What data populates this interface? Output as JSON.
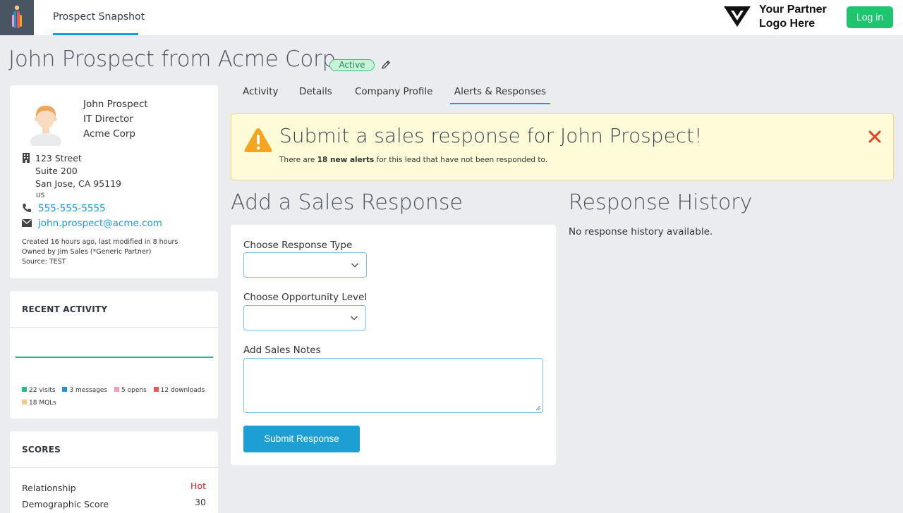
{
  "topbar": {
    "nav_tab": "Prospect Snapshot",
    "partner_logo_text": "Your Partner\nLogo Here",
    "login_label": "Log in"
  },
  "page": {
    "title": "John Prospect from Acme Corp",
    "status": "Active"
  },
  "profile": {
    "name": "John Prospect",
    "job_title": "IT Director",
    "company": "Acme Corp",
    "address": [
      "123 Street",
      "Suite 200",
      "San Jose, CA 95119"
    ],
    "country": "US",
    "phone": "555-555-5555",
    "email": "john.prospect@acme.com",
    "meta": [
      "Created 16 hours ago, last modified in 8 hours",
      "Owned by Jim Sales (*Generic Partner)",
      "Source: TEST"
    ]
  },
  "recent_activity": {
    "header": "RECENT ACTIVITY",
    "legend": [
      {
        "label": "22 visits",
        "color": "#22c083"
      },
      {
        "label": "3 messages",
        "color": "#1f94cf"
      },
      {
        "label": "5 opens",
        "color": "#f29bc8"
      },
      {
        "label": "12 downloads",
        "color": "#ee5555"
      },
      {
        "label": "18 MQLs",
        "color": "#f6c98a"
      }
    ],
    "line_color": "#1fb88a"
  },
  "scores": {
    "header": "SCORES",
    "items": [
      {
        "label": "Relationship",
        "value": "Hot",
        "color": "#d9202a"
      },
      {
        "label": "Demographic Score",
        "value": "30",
        "color": "#333333"
      }
    ]
  },
  "tabs": {
    "items": [
      "Activity",
      "Details",
      "Company Profile",
      "Alerts & Responses"
    ],
    "active": "Alerts & Responses"
  },
  "alert": {
    "title": "Submit a sales response for John Prospect!",
    "text_before": "There are ",
    "text_bold": "18 new alerts",
    "text_after": " for this lead that have not been responded to."
  },
  "sales_response": {
    "title": "Add a Sales Response",
    "response_type_label": "Choose Response Type",
    "response_type_value": "",
    "opportunity_label": "Choose Opportunity Level",
    "opportunity_value": "",
    "notes_label": "Add Sales Notes",
    "notes_value": "",
    "submit_label": "Submit Response"
  },
  "history": {
    "title": "Response History",
    "empty_text": "No response history available."
  },
  "colors": {
    "accent": "#1a9ad6",
    "login_green": "#1fc46f",
    "alert_bg": "#fdfbd8",
    "warning_orange": "#f2a51d",
    "close_red": "#e8401c"
  }
}
